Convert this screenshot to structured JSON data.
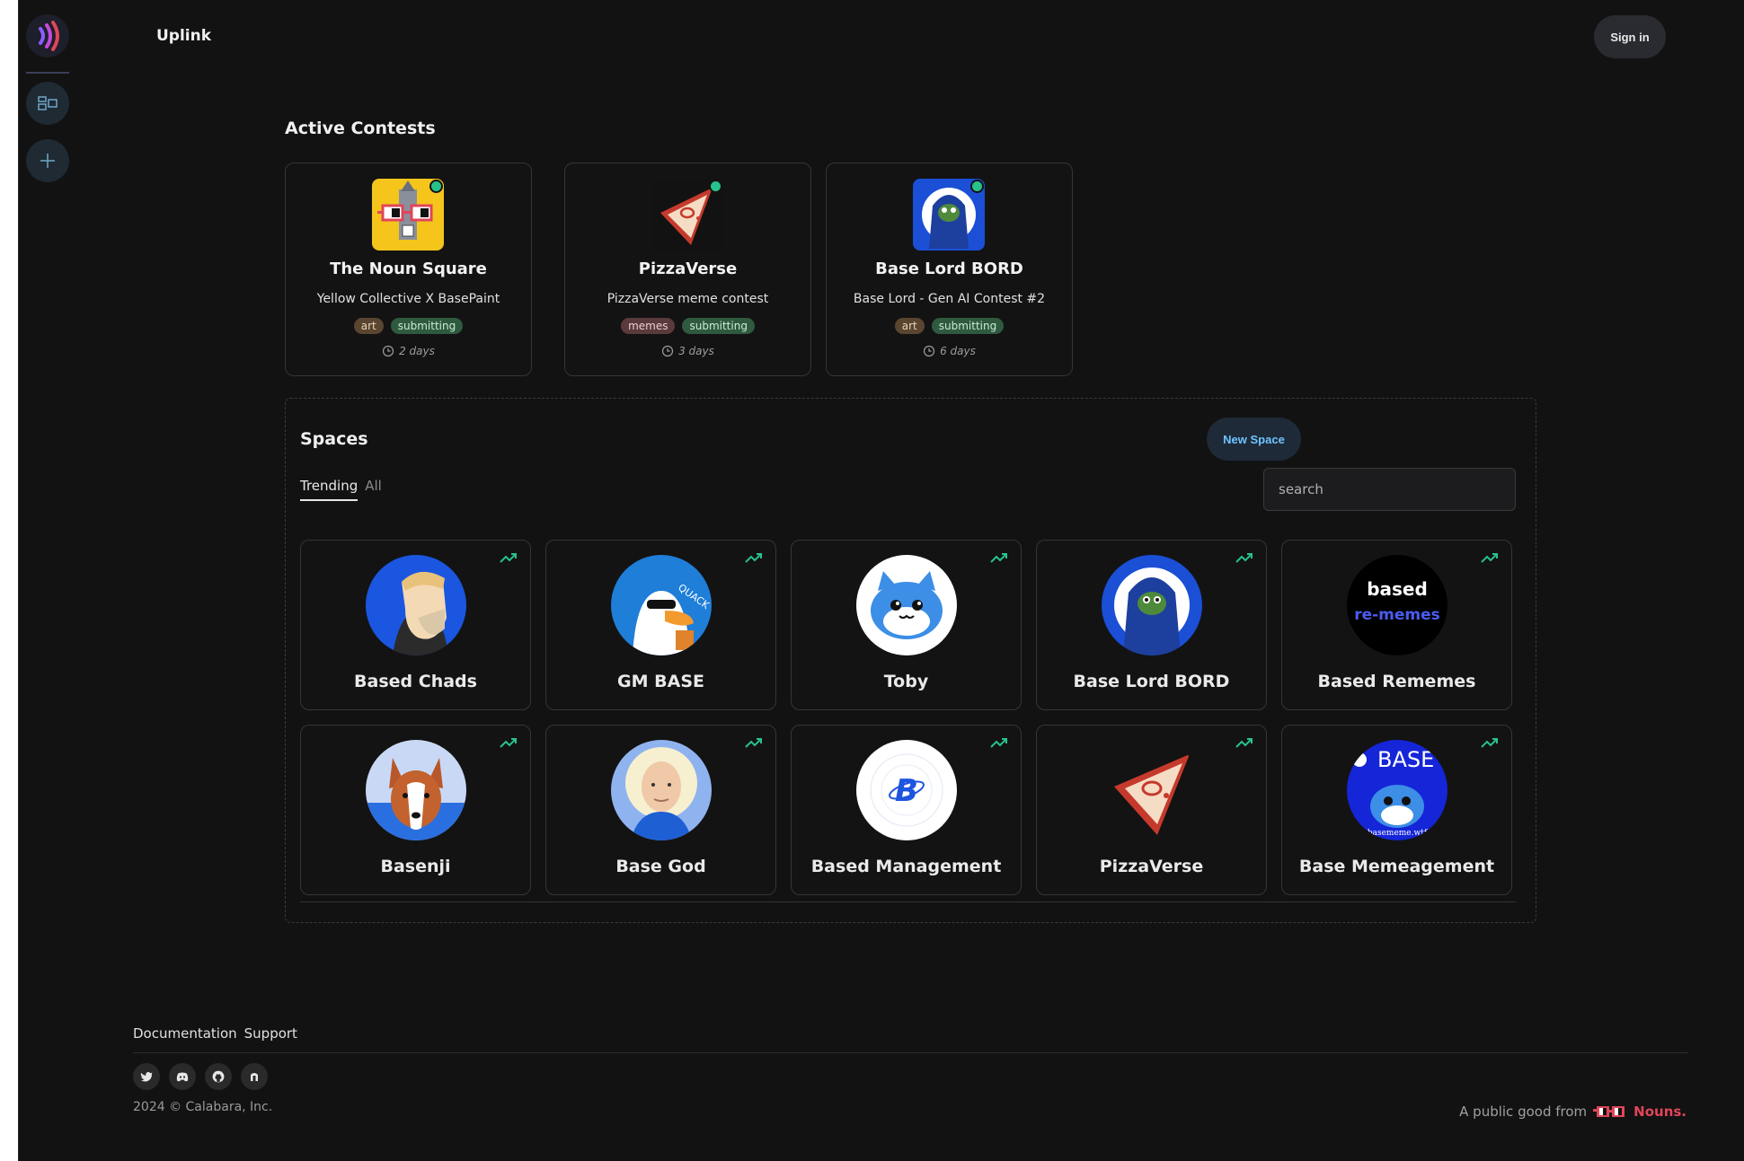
{
  "brand": "Uplink",
  "header": {
    "signin_label": "Sign in"
  },
  "contests": {
    "title": "Active Contests",
    "items": [
      {
        "name": "The Noun Square",
        "description": "Yellow Collective X BasePaint",
        "tags": [
          "art",
          "submitting"
        ],
        "time": "2 days",
        "icon": "noun-square-avatar"
      },
      {
        "name": "PizzaVerse",
        "description": "PizzaVerse meme contest",
        "tags": [
          "memes",
          "submitting"
        ],
        "time": "3 days",
        "icon": "pizza-avatar"
      },
      {
        "name": "Base Lord BORD",
        "description": "Base Lord - Gen AI Contest #2",
        "tags": [
          "art",
          "submitting"
        ],
        "time": "6 days",
        "icon": "base-lord-avatar"
      }
    ]
  },
  "spaces": {
    "title": "Spaces",
    "new_space_label": "New Space",
    "tabs": [
      "Trending",
      "All"
    ],
    "search_placeholder": "search",
    "items": [
      {
        "name": "Based Chads",
        "icon": "chad-avatar"
      },
      {
        "name": "GM BASE",
        "icon": "duck-avatar"
      },
      {
        "name": "Toby",
        "icon": "toby-avatar"
      },
      {
        "name": "Base Lord BORD",
        "icon": "base-lord-avatar"
      },
      {
        "name": "Based Rememes",
        "icon": "rememes-avatar"
      },
      {
        "name": "Basenji",
        "icon": "basenji-avatar"
      },
      {
        "name": "Base God",
        "icon": "base-god-avatar"
      },
      {
        "name": "Based Management",
        "icon": "based-b-avatar"
      },
      {
        "name": "PizzaVerse",
        "icon": "pizza-avatar"
      },
      {
        "name": "Base Memeagement",
        "icon": "base-meme-avatar"
      }
    ],
    "avatar_text": {
      "rememes_top": "based",
      "rememes_bottom": "re-memes",
      "gm_quack": "QUACK",
      "base_word": "BASE",
      "basememe_url": "basememe.wtf"
    }
  },
  "footer": {
    "links": [
      "Documentation",
      "Support"
    ],
    "socials": [
      "twitter-icon",
      "discord-icon",
      "github-icon",
      "nouns-icon"
    ],
    "copyright": "2024 © Calabara, Inc.",
    "public_good": "A public good from",
    "nouns_label": "Nouns."
  },
  "colors": {
    "accent_green": "#27c28b",
    "brand_pink": "#e0455a",
    "link_blue": "#6ec4ff"
  }
}
